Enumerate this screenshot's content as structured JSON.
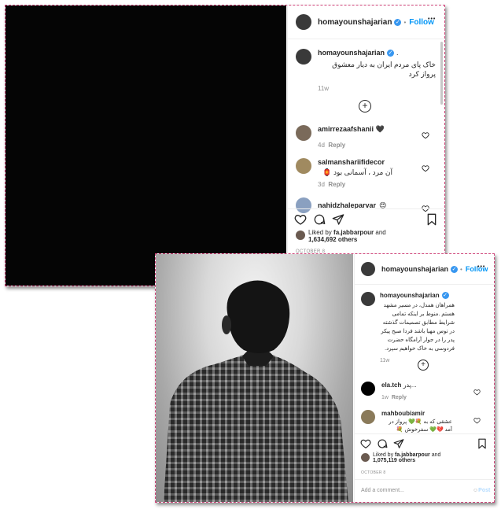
{
  "post1": {
    "username": "homayounshajarian",
    "follow_label": "Follow",
    "separator": "•",
    "more": "•••",
    "caption_username": "homayounshajarian",
    "caption_dot": ".",
    "caption_text": "خاک پای مردم ایران به دیار معشوق پرواز کرد",
    "caption_age": "11w",
    "comments": [
      {
        "username": "amirrezaafshanii",
        "text": "🖤",
        "age": "4d",
        "reply": "Reply"
      },
      {
        "username": "salmanshariifidecor",
        "text": "آن مرد ، آسمانی بود 🏮",
        "age": "3d",
        "reply": "Reply"
      },
      {
        "username": "nahidzhaleparvar",
        "text": "😍",
        "age": "",
        "reply": ""
      }
    ],
    "liked_by_prefix": "Liked by",
    "liked_by_user": "fa.jabbarpour",
    "liked_by_and": "and",
    "likes_count": "1,634,692 others",
    "date": "OCTOBER 8"
  },
  "post2": {
    "username": "homayounshajarian",
    "follow_label": "Follow",
    "separator": "•",
    "more": "•••",
    "caption_username": "homayounshajarian",
    "caption_text": "همراهان همدل، در مسیر مشهد هستم .منوط بر اینکه تمامی شرایط مطابق تصمیمات گذشته در توس مهیا باشد فردا صبح پیکر پدر را در جوار آرامگاه حضرت فردوسی به خاک خواهیم سپرد.",
    "caption_age": "11w",
    "comments": [
      {
        "username": "ela.tch",
        "text": "پدر...",
        "age": "1w",
        "reply": "Reply"
      },
      {
        "username": "mahboubiamir",
        "text": "عشقی که به 💐💚 پرواز در آمد 💔💚 سفرخوش 💐 خوشبخت 💚🧡🏮 همت تا ابد",
        "age": "",
        "reply": ""
      }
    ],
    "liked_by_prefix": "Liked by",
    "liked_by_user": "fa.jabbarpour",
    "liked_by_and": "and",
    "likes_count": "1,075,119 others",
    "date": "OCTOBER 8",
    "add_comment_placeholder": "Add a comment...",
    "post_label": "Post"
  },
  "colors": {
    "accent": "#0095f6",
    "verified": "#3897f0",
    "frame": "#d0457a",
    "text": "#262626",
    "muted": "#8e8e8e"
  }
}
